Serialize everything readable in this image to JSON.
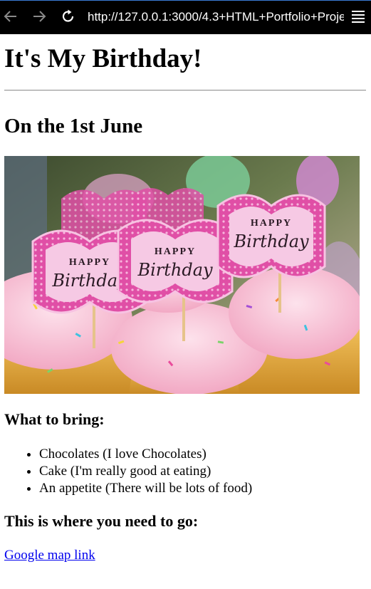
{
  "browser": {
    "url": "http://127.0.0.1:3000/4.3+HTML+Portfolio+Proje",
    "back_icon": "arrow-left-icon",
    "forward_icon": "arrow-right-icon",
    "reload_icon": "reload-icon",
    "menu_icon": "hamburger-menu-icon"
  },
  "page": {
    "title": "It's My Birthday!",
    "date_heading": "On the 1st June",
    "image_caption_text": [
      "HAPPY",
      "Birthday"
    ],
    "bring_heading": "What to bring:",
    "bring_items": [
      "Chocolates (I love Chocolates)",
      "Cake (I'm really good at eating)",
      "An appetite (There will be lots of food)"
    ],
    "go_heading": "This is where you need to go:",
    "map_link": "Google map link",
    "link_color": "#0000ee"
  }
}
